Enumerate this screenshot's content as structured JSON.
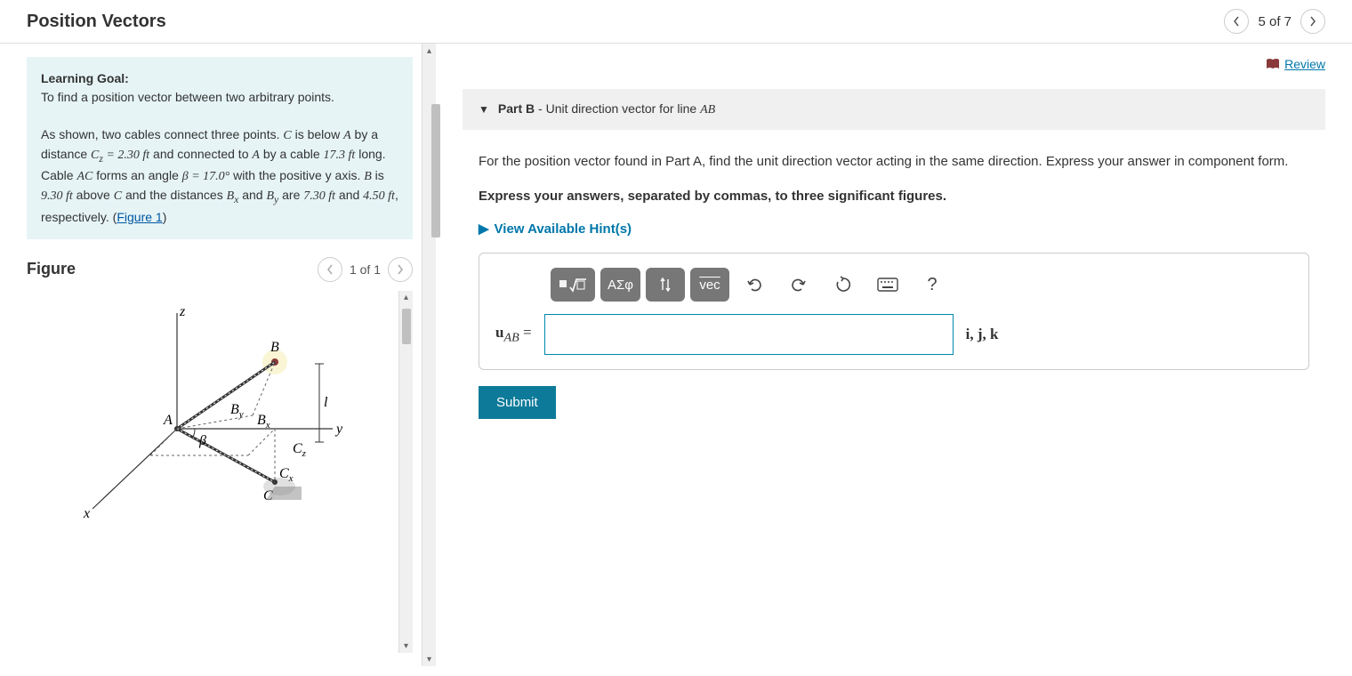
{
  "header": {
    "title": "Position Vectors",
    "page_label": "5 of 7"
  },
  "goal": {
    "heading": "Learning Goal:",
    "intro": "To find a position vector between two arbitrary points.",
    "body_prefix": "As shown, two cables connect three points. ",
    "C": "C",
    "is_below": " is below ",
    "A": "A",
    "by_dist": " by a distance ",
    "Cz_eq": "C_z = 2.30 ft",
    "and_conn": " and connected to ",
    "A2": "A",
    "by_cable": " by a cable ",
    "cable_len": "17.3 ft",
    "long_cable": " long. Cable ",
    "AC": "AC",
    "forms_angle": " forms an angle ",
    "beta_eq": "β = 17.0°",
    "with_y": " with the positive y axis. ",
    "B": "B",
    "is_above": " is ",
    "B_above_val": "9.30 ft",
    "above_C": " above ",
    "C2": "C",
    "and_dist": " and the distances ",
    "Bx": "B_x",
    "and": " and ",
    "By": "B_y",
    "are": " are ",
    "Bx_val": "7.30 ft",
    "and2": " and ",
    "By_val": "4.50 ft",
    "resp": ", respectively. (",
    "fig_link": "Figure 1",
    "close": ")"
  },
  "figure": {
    "heading": "Figure",
    "page": "1 of 1"
  },
  "review": "Review",
  "part": {
    "label": "Part B",
    "dash": " - ",
    "title": "Unit direction vector for line ",
    "title_var": "AB",
    "instr": "For the position vector found in Part A, find the unit direction vector acting in the same direction. Express your answer in component form.",
    "express": "Express your answers, separated by commas, to three significant figures.",
    "hints": "View Available Hint(s)"
  },
  "toolbar": {
    "greek": "ΑΣφ",
    "vec": "vec",
    "help": "?"
  },
  "answer": {
    "label_u": "u",
    "label_sub": "AB",
    "equals": " = ",
    "units": "i, j, k"
  },
  "submit": "Submit",
  "values": {
    "Cz": 2.3,
    "cable_AC_length": 17.3,
    "beta_deg": 17.0,
    "B_above_C": 9.3,
    "Bx": 7.3,
    "By": 4.5
  }
}
